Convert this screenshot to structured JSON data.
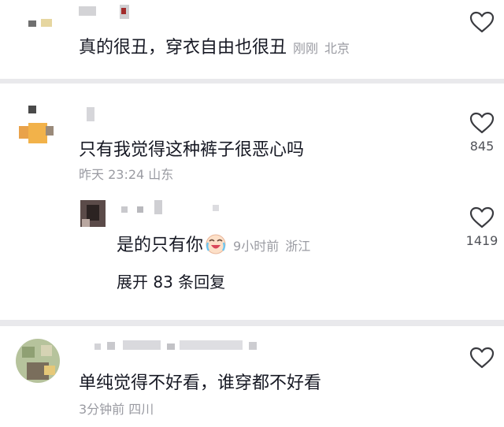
{
  "comments": [
    {
      "username": "",
      "text": "真的很丑，穿衣自由也很丑",
      "time": "刚刚",
      "location": "北京",
      "like_count": "",
      "icon": "heart-outline-icon"
    },
    {
      "username": "",
      "text": "只有我觉得这种裤子很恶心吗",
      "time": "昨天 23:24",
      "location": "山东",
      "like_count": "845",
      "icon": "heart-outline-icon",
      "reply": {
        "username": "",
        "text": "是的只有你",
        "emoji": "crying-laughing-emoji",
        "time": "9小时前",
        "location": "浙江",
        "like_count": "1419"
      },
      "expand_label": "展开 83 条回复"
    },
    {
      "username": "",
      "text": "单纯觉得不好看，谁穿都不好看",
      "time": "3分钟前",
      "location": "四川",
      "like_count": "",
      "icon": "heart-outline-icon"
    }
  ],
  "colors": {
    "text": "#161823",
    "meta": "#9a9ba2",
    "count": "#505258",
    "background": "#e9e9ec",
    "card": "#ffffff"
  }
}
